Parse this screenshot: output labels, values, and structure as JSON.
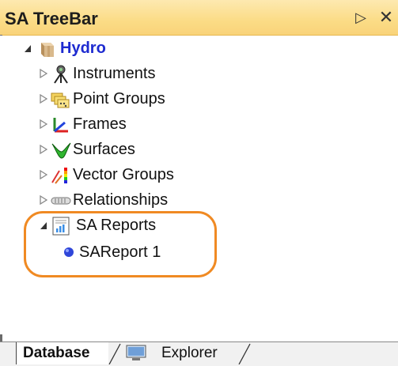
{
  "panel": {
    "title": "SA TreeBar",
    "pin_glyph": "▷",
    "close_glyph": "✕"
  },
  "tree": {
    "root": {
      "label": "Hydro",
      "icon": "hydro-package-icon",
      "expanded": true
    },
    "children": [
      {
        "label": "Instruments",
        "icon": "instrument-icon",
        "expanded": false
      },
      {
        "label": "Point Groups",
        "icon": "point-groups-icon",
        "expanded": false
      },
      {
        "label": "Frames",
        "icon": "frames-icon",
        "expanded": false
      },
      {
        "label": "Surfaces",
        "icon": "surfaces-icon",
        "expanded": false
      },
      {
        "label": "Vector Groups",
        "icon": "vector-groups-icon",
        "expanded": false
      },
      {
        "label": "Relationships",
        "icon": "relationships-icon",
        "expanded": false
      },
      {
        "label": "SA Reports",
        "icon": "sa-reports-icon",
        "expanded": true,
        "children": [
          {
            "label": "SAReport 1",
            "icon": "report-bullet-icon"
          }
        ]
      }
    ]
  },
  "tabs": [
    {
      "label": "Database",
      "active": true
    },
    {
      "label": "Explorer",
      "icon": "monitor-icon",
      "active": false
    }
  ],
  "colors": {
    "title_bg": "#fbdc86",
    "root_text": "#1e2bd0",
    "highlight": "#f08a23"
  }
}
